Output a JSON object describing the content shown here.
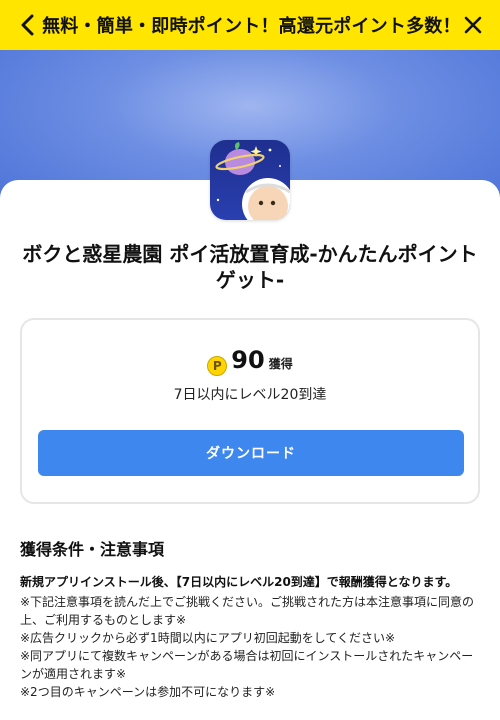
{
  "banner": {
    "title": "無料・簡単・即時ポイント！高還元ポイント多数！"
  },
  "app": {
    "name": "ボクと惑星農園 ポイ活放置育成-かんたんポイントゲット-"
  },
  "reward": {
    "coin_symbol": "P",
    "points": "90",
    "unit": "獲得",
    "condition": "7日以内にレベル20到達",
    "download_label": "ダウンロード"
  },
  "notes": {
    "title": "獲得条件・注意事項",
    "lead": "新規アプリインストール後、【7日以内にレベル20到達】で報酬獲得となります。",
    "items": [
      "※下記注意事項を読んだ上でご挑戦ください。ご挑戦された方は本注意事項に同意の上、ご利用するものとします※",
      "※広告クリックから必ず1時間以内にアプリ初回起動をしてください※",
      "※同アプリにて複数キャンペーンがある場合は初回にインストールされたキャンペーンが適用されます※",
      "※2つ目のキャンペーンは参加不可になります※"
    ]
  },
  "colors": {
    "banner_bg": "#ffe500",
    "hero_bg": "#5b7fdc",
    "button_bg": "#3d87ef",
    "coin": "#ffd400"
  }
}
